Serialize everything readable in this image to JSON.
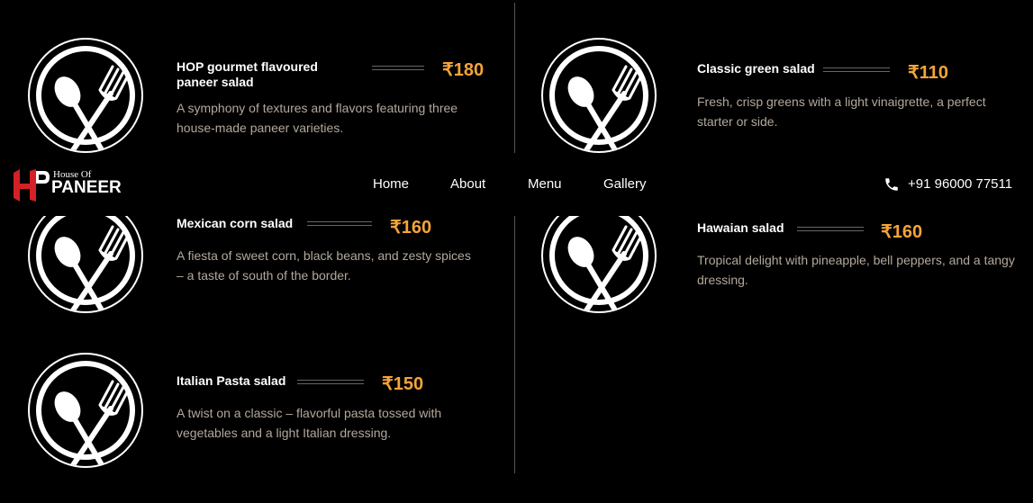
{
  "nav": {
    "logo_small": "House Of",
    "logo_big": "PANEER",
    "links": [
      "Home",
      "About",
      "Menu",
      "Gallery"
    ],
    "phone": "+91 96000 77511"
  },
  "menu": [
    {
      "title": "HOP gourmet flavoured paneer salad",
      "price": "₹180",
      "description": "A symphony of textures and flavors featuring three house-made paneer varieties."
    },
    {
      "title": "Classic green salad",
      "price": "₹110",
      "description": "Fresh, crisp greens with a light vinaigrette, a perfect starter or side."
    },
    {
      "title": "Mexican corn salad",
      "price": "₹160",
      "description": "A fiesta of sweet corn, black beans, and zesty spices – a taste of south of the border."
    },
    {
      "title": "Hawaian salad",
      "price": "₹160",
      "description": "Tropical delight with pineapple, bell peppers, and a tangy dressing."
    },
    {
      "title": "Italian Pasta salad",
      "price": "₹150",
      "description": "A twist on a classic – flavorful pasta tossed with vegetables and a light Italian dressing."
    }
  ],
  "colors": {
    "price": "#f4a43a",
    "logo_red": "#d42027",
    "background": "#000000"
  },
  "icons": {
    "dish": "spoon-fork-plate-icon",
    "phone": "phone-icon"
  }
}
